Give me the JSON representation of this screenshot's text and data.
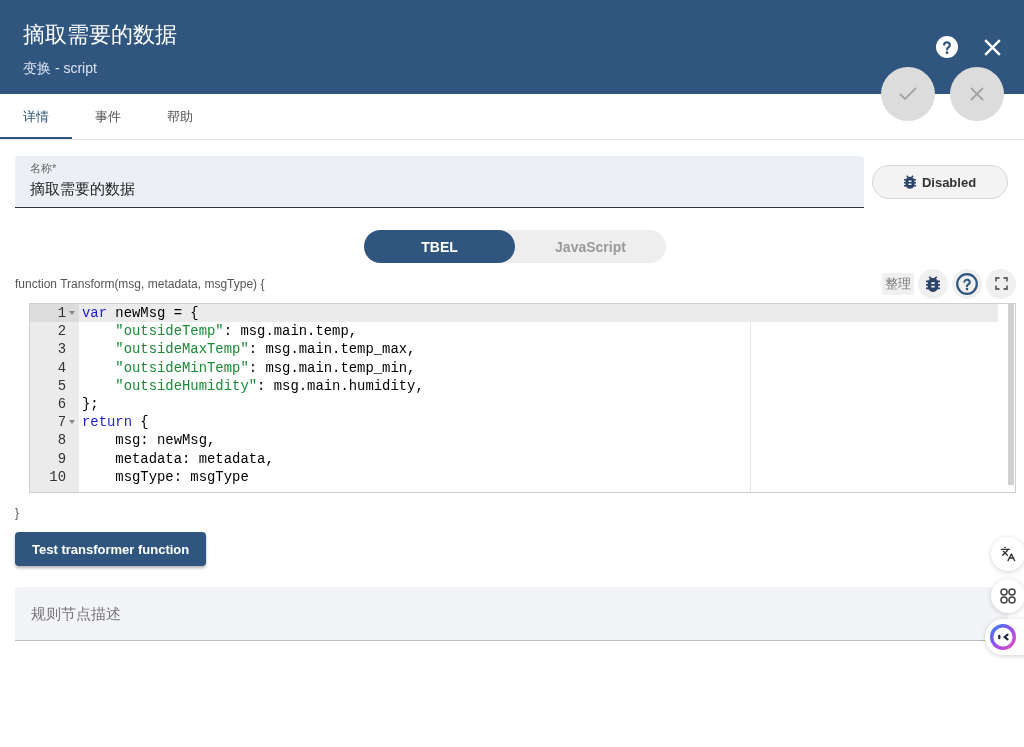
{
  "header": {
    "title": "摘取需要的数据",
    "subtitle": "变换 - script",
    "actions": [
      {
        "kind": "apply",
        "disabled": true
      },
      {
        "kind": "cancel",
        "disabled": true
      }
    ]
  },
  "tabs": [
    {
      "label": "详情",
      "selected": true
    },
    {
      "label": "事件",
      "selected": false
    },
    {
      "label": "帮助",
      "selected": false
    }
  ],
  "name_field": {
    "label": "名称*",
    "value": "摘取需要的数据"
  },
  "debug_button": {
    "label": "Disabled"
  },
  "language_toggle": [
    {
      "label": "TBEL",
      "selected": true
    },
    {
      "label": "JavaScript",
      "selected": false
    }
  ],
  "script": {
    "signature": "function Transform(msg, metadata, msgType) {",
    "tidy_button": "整理",
    "lines": [
      {
        "number": "1",
        "fold": true,
        "active": true,
        "tokens": [
          {
            "kind": "keyword",
            "text": "var"
          },
          {
            "kind": "plain",
            "text": " newMsg = {"
          }
        ]
      },
      {
        "number": "2",
        "fold": false,
        "active": false,
        "tokens": [
          {
            "kind": "string",
            "text": "    \"outsideTemp\""
          },
          {
            "kind": "plain",
            "text": ": msg.main.temp,"
          }
        ]
      },
      {
        "number": "3",
        "fold": false,
        "active": false,
        "tokens": [
          {
            "kind": "string",
            "text": "    \"outsideMaxTemp\""
          },
          {
            "kind": "plain",
            "text": ": msg.main.temp_max,"
          }
        ]
      },
      {
        "number": "4",
        "fold": false,
        "active": false,
        "tokens": [
          {
            "kind": "string",
            "text": "    \"outsideMinTemp\""
          },
          {
            "kind": "plain",
            "text": ": msg.main.temp_min,"
          }
        ]
      },
      {
        "number": "5",
        "fold": false,
        "active": false,
        "tokens": [
          {
            "kind": "string",
            "text": "    \"outsideHumidity\""
          },
          {
            "kind": "plain",
            "text": ": msg.main.humidity,"
          }
        ]
      },
      {
        "number": "6",
        "fold": false,
        "active": false,
        "tokens": [
          {
            "kind": "plain",
            "text": "};"
          }
        ]
      },
      {
        "number": "7",
        "fold": true,
        "active": false,
        "tokens": [
          {
            "kind": "keyword",
            "text": "return"
          },
          {
            "kind": "plain",
            "text": " {"
          }
        ]
      },
      {
        "number": "8",
        "fold": false,
        "active": false,
        "tokens": [
          {
            "kind": "plain",
            "text": "    msg: newMsg,"
          }
        ]
      },
      {
        "number": "9",
        "fold": false,
        "active": false,
        "tokens": [
          {
            "kind": "plain",
            "text": "    metadata: metadata,"
          }
        ]
      },
      {
        "number": "10",
        "fold": false,
        "active": false,
        "tokens": [
          {
            "kind": "plain",
            "text": "    msgType: msgType"
          }
        ]
      }
    ],
    "closing": "}"
  },
  "test_button": {
    "label": "Test transformer function"
  },
  "description_field": {
    "placeholder": "规则节点描述"
  }
}
